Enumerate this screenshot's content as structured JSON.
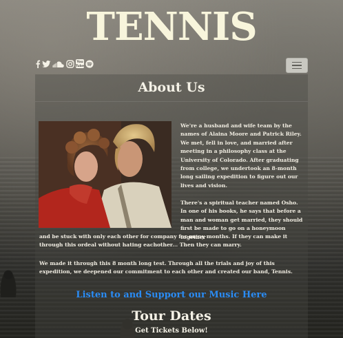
{
  "site": {
    "logo_text": "TENNIS"
  },
  "social": {
    "icons": [
      "facebook-icon",
      "twitter-icon",
      "soundcloud-icon",
      "instagram-icon",
      "youtube-icon",
      "spotify-icon"
    ],
    "youtube_label": "You Tube"
  },
  "nav": {
    "menu_icon": "hamburger-icon"
  },
  "about": {
    "title": "About Us",
    "para1": "We're a husband and wife team by the names of Alaina Moore and Patrick Riley. We met, fell in love, and married after meeting in a philosophy class at the University of Colorado. After graduating from college, we undertook an 8-month long sailing expedition to figure out our lives and vision.",
    "para2_top": "There's a spiritual teacher named Osho. In one of his books, he says that before a man and woman get married, they should first be made to go on a honeymoon together",
    "para2_bottom": "and be stuck with only each other for company for many months. If they can make it through this ordeal without hating eachother... Then they can marry.",
    "para3": "We made it through this 8 month long test. Through all the trials and joy of this expedition, we deepened our commitment to each other and created our band, Tennis."
  },
  "music_link": {
    "label": "Listen to and Support our Music Here"
  },
  "tour": {
    "title": "Tour Dates",
    "subtitle": "Get Tickets Below!"
  },
  "colors": {
    "logo": "#f8f5dc",
    "link": "#2a8cf5",
    "text": "#f4f1e6"
  }
}
